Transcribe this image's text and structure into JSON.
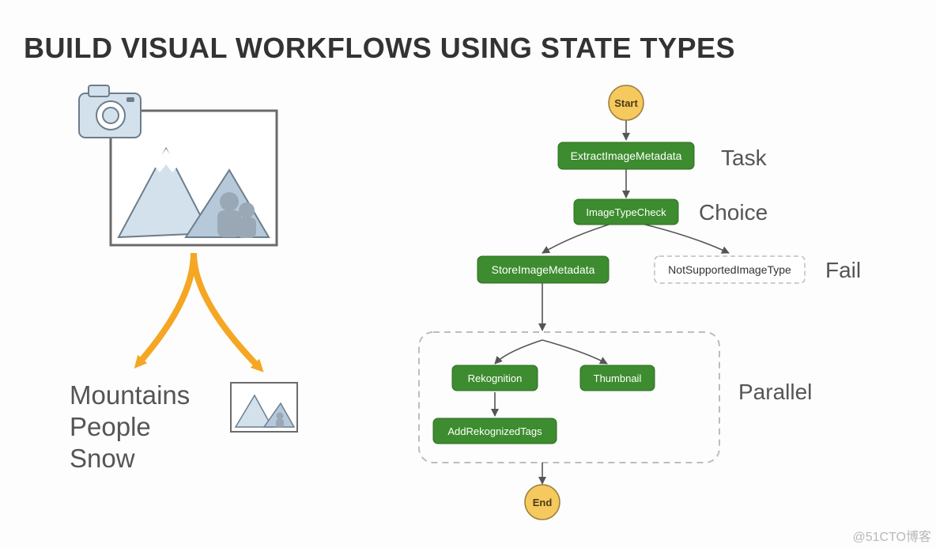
{
  "title": "BUILD VISUAL WORKFLOWS USING STATE TYPES",
  "watermark": "@51CTO博客",
  "left_illustration": {
    "tags": [
      "Mountains",
      "People",
      "Snow"
    ]
  },
  "flow": {
    "start_label": "Start",
    "end_label": "End",
    "nodes": {
      "extract": "ExtractImageMetadata",
      "check": "ImageTypeCheck",
      "store": "StoreImageMetadata",
      "fail": "NotSupportedImageType",
      "rekognition": "Rekognition",
      "add_tags": "AddRekognizedTags",
      "thumbnail": "Thumbnail"
    },
    "annotations": {
      "task": "Task",
      "choice": "Choice",
      "fail": "Fail",
      "parallel": "Parallel"
    }
  },
  "colors": {
    "node_green": "#3d8c2f",
    "node_text": "#ffffff",
    "terminal_fill": "#f6c95e",
    "terminal_stroke": "#9a7f3a",
    "arrow_orange": "#f5a623",
    "parallel_dash": "#bdbdbd",
    "fail_dash": "#bdbdbd",
    "illus_stroke": "#6c7d8c",
    "illus_fill": "#d3e1ec",
    "illus_fill2": "#b6c9da"
  }
}
